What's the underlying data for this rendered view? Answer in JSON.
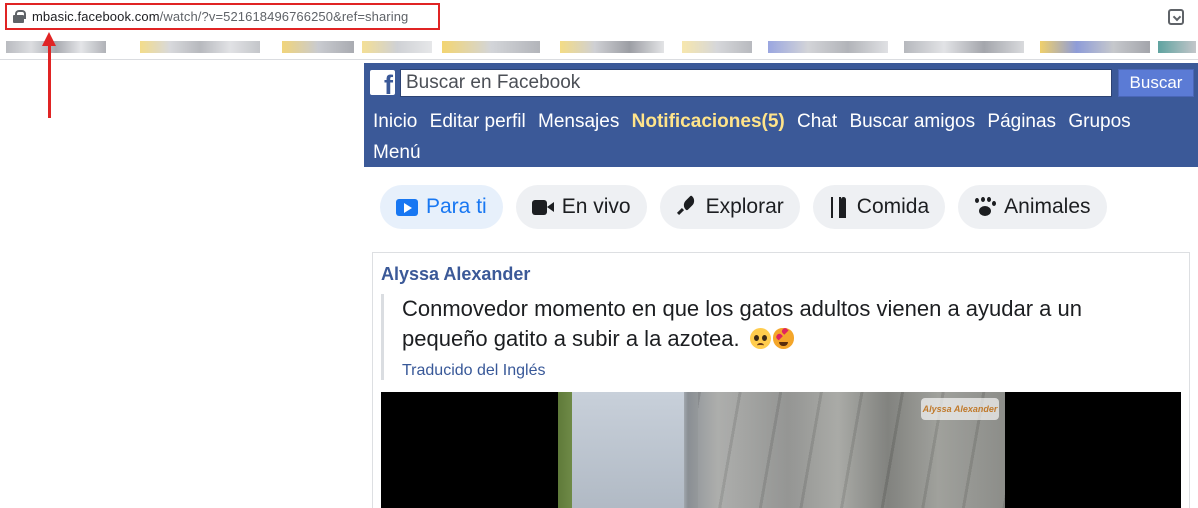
{
  "browser": {
    "url_host": "mbasic.facebook.com",
    "url_path": "/watch/?v=521618496766250&ref=sharing"
  },
  "header": {
    "logo_letter": "f",
    "search_placeholder": "Buscar en Facebook",
    "search_button": "Buscar",
    "nav": [
      {
        "label": "Inicio"
      },
      {
        "label": "Editar perfil"
      },
      {
        "label": "Mensajes"
      },
      {
        "label": "Notificaciones(5)"
      },
      {
        "label": "Chat"
      },
      {
        "label": "Buscar amigos"
      },
      {
        "label": "Páginas"
      },
      {
        "label": "Grupos"
      },
      {
        "label": "Menú"
      }
    ]
  },
  "tabs": [
    {
      "label": "Para ti",
      "icon": "play-icon",
      "active": true
    },
    {
      "label": "En vivo",
      "icon": "live-video-icon"
    },
    {
      "label": "Explorar",
      "icon": "rocket-icon"
    },
    {
      "label": "Comida",
      "icon": "fork-knife-icon"
    },
    {
      "label": "Animales",
      "icon": "paw-icon"
    }
  ],
  "post": {
    "author": "Alyssa Alexander",
    "text": "Conmovedor momento en que los gatos adultos vienen a ayudar a un pequeño gatito a subir a la azotea.",
    "emojis": [
      "pleading-face-icon",
      "heart-eyes-cat-icon"
    ],
    "translated_label": "Traducido del Inglés",
    "video_watermark": "Alyssa Alexander"
  },
  "colors": {
    "facebook_blue": "#3b5998",
    "notification_highlight": "#ffe48a",
    "active_tab": "#1877f2",
    "annotation_red": "#e02424"
  }
}
